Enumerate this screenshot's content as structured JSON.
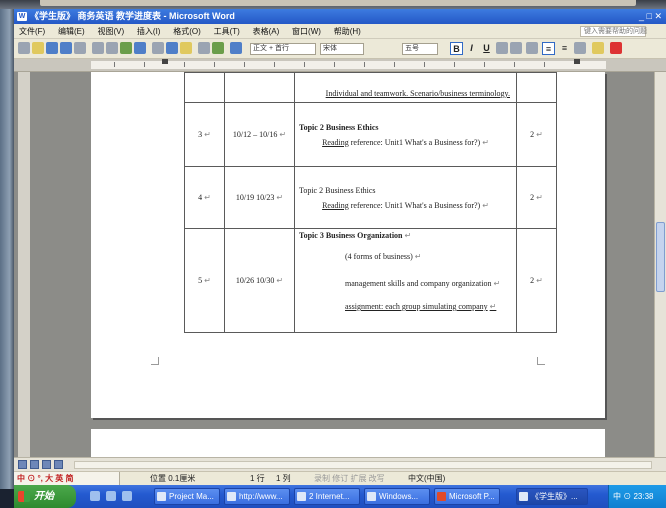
{
  "window": {
    "title": "《学生版》 商务英语 教学进度表 - Microsoft Word",
    "right_hint": "_ □ ✕"
  },
  "menu": {
    "items": [
      "文件(F)",
      "编辑(E)",
      "视图(V)",
      "插入(I)",
      "格式(O)",
      "工具(T)",
      "表格(A)",
      "窗口(W)",
      "帮助(H)"
    ],
    "help_placeholder": "键入需要帮助的问题"
  },
  "toolbar": {
    "style_value": "正文 + 首行",
    "font_value": "宋体",
    "size_value": "五号",
    "bold": "B",
    "italic": "I",
    "underline": "U",
    "align_left": "≡",
    "align_center": "≡"
  },
  "table": {
    "partial_row_text": "Individual and teamwork. Scenario/business terminology.",
    "rows": [
      {
        "num": "3",
        "dates": "10/12 – 10/16",
        "topic_title": "Topic 2 Business Ethics",
        "reading_label": "Reading",
        "reading_text": " reference: Unit1 What's a Business for?)",
        "hours": "2"
      },
      {
        "num": "4",
        "dates": "10/19 10/23",
        "topic_title": "Topic 2 Business Ethics",
        "reading_label": "Reading",
        "reading_text": " reference: Unit1 What's a Business for?)",
        "hours": "2"
      },
      {
        "num": "5",
        "dates": "10/26 10/30",
        "topic_title": "Topic 3 Business Organization",
        "line1": "(4 forms of business)",
        "line2": "management skills and company organization",
        "line3": "assignment: each group simulating company",
        "hours": "2"
      }
    ],
    "para_mark": "↵"
  },
  "status": {
    "ime": "中 ⊙ °, 大 英 简",
    "page": "位置 0.1厘米",
    "line": "1 行",
    "col": "1 列",
    "modes": "录制 修订 扩展 改写",
    "lang": "中文(中国)"
  },
  "taskbar": {
    "start": "开始",
    "tasks": [
      "Project Ma...",
      "http://www...",
      "2 Internet...",
      "Windows...",
      "Microsoft P...",
      "《学生版》..."
    ],
    "tray_text": "中 ⊙ 23:38"
  },
  "colors": {
    "title_bar": "#2458c6",
    "taskbar": "#245ad0",
    "start_button": "#2e8a2e"
  }
}
